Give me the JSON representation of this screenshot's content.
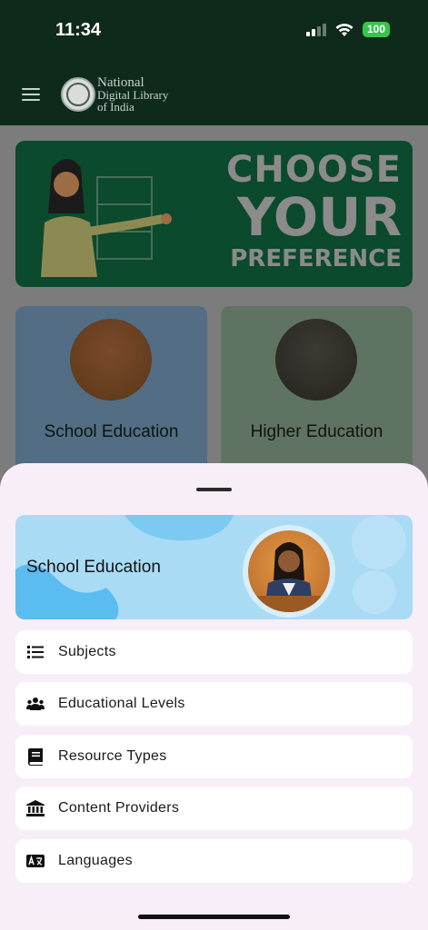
{
  "status_bar": {
    "time": "11:34",
    "battery": "100"
  },
  "header": {
    "brand_line1": "National",
    "brand_line2": "Digital Library",
    "brand_line3": "of India"
  },
  "background": {
    "banner": {
      "line1": "CHOOSE",
      "line2": "YOUR",
      "line3": "PREFERENCE"
    },
    "cards": [
      {
        "label": "School Education"
      },
      {
        "label": "Higher Education"
      }
    ]
  },
  "sheet": {
    "title": "School Education",
    "items": [
      {
        "label": "Subjects",
        "icon": "list-icon"
      },
      {
        "label": "Educational Levels",
        "icon": "users-icon"
      },
      {
        "label": "Resource Types",
        "icon": "book-icon"
      },
      {
        "label": "Content Providers",
        "icon": "institution-icon"
      },
      {
        "label": "Languages",
        "icon": "language-icon"
      }
    ]
  },
  "colors": {
    "header_bg": "#0e2a1b",
    "sheet_bg": "#f7eef7",
    "hero_bg": "#a9dbf5",
    "banner_bg": "#0b4a2c",
    "battery": "#36c54c"
  }
}
